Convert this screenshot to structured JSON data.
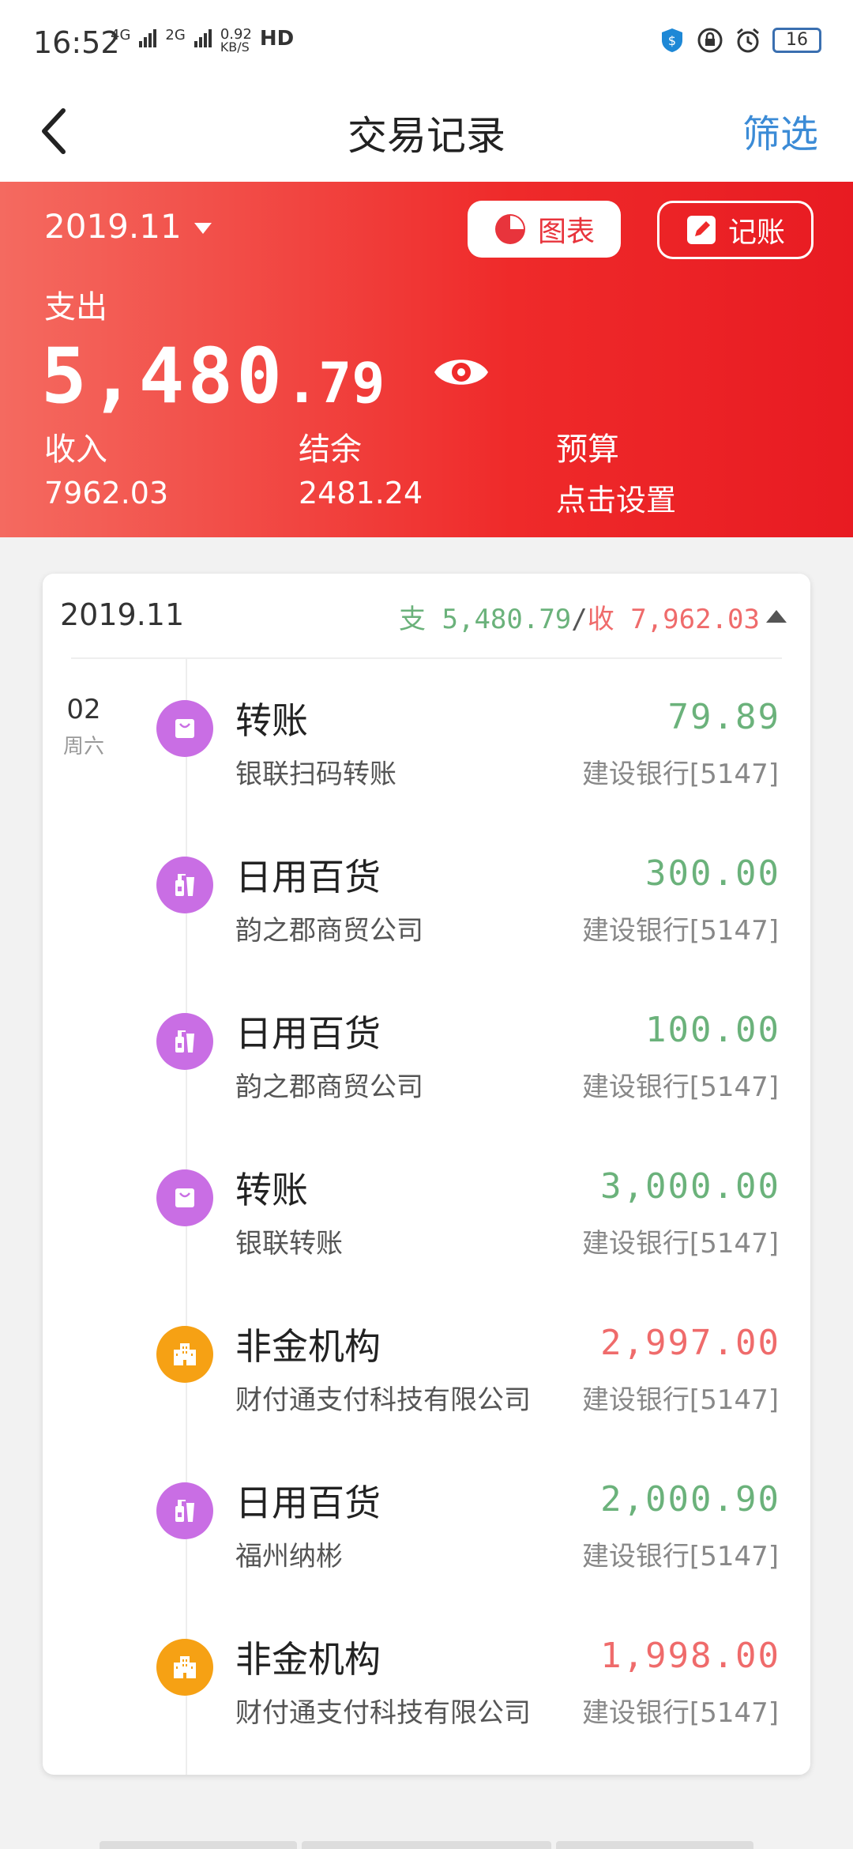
{
  "status": {
    "time": "16:52",
    "net_4g": "4G",
    "net_2g": "2G",
    "speed_value": "0.92",
    "speed_unit": "KB/S",
    "hd": "HD",
    "battery": "16"
  },
  "header": {
    "title": "交易记录",
    "filter_label": "筛选"
  },
  "banner": {
    "month": "2019.11",
    "chart_label": "图表",
    "book_label": "记账",
    "spend_label": "支出",
    "spend_int": "5,480",
    "spend_dec": ".79",
    "income_label": "收入",
    "income_value": "7962.03",
    "balance_label": "结余",
    "balance_value": "2481.24",
    "budget_label": "预算",
    "budget_value": "点击设置"
  },
  "card": {
    "month": "2019.11",
    "out_label": "支",
    "out_total": "5,480.79",
    "separator": "/",
    "in_label": "收",
    "in_total": "7,962.03",
    "date_day": "02",
    "date_week": "周六",
    "transactions": [
      {
        "category": "转账",
        "desc": "银联扫码转账",
        "amount": "79.89",
        "direction": "out",
        "account": "建设银行[5147]",
        "icon": "shopping-bag-icon"
      },
      {
        "category": "日用百货",
        "desc": "韵之郡商贸公司",
        "amount": "300.00",
        "direction": "out",
        "account": "建设银行[5147]",
        "icon": "toiletries-icon"
      },
      {
        "category": "日用百货",
        "desc": "韵之郡商贸公司",
        "amount": "100.00",
        "direction": "out",
        "account": "建设银行[5147]",
        "icon": "toiletries-icon"
      },
      {
        "category": "转账",
        "desc": "银联转账",
        "amount": "3,000.00",
        "direction": "out",
        "account": "建设银行[5147]",
        "icon": "shopping-bag-icon"
      },
      {
        "category": "非金机构",
        "desc": "财付通支付科技有限公司",
        "amount": "2,997.00",
        "direction": "in",
        "account": "建设银行[5147]",
        "icon": "building-icon"
      },
      {
        "category": "日用百货",
        "desc": "福州纳彬",
        "amount": "2,000.90",
        "direction": "out",
        "account": "建设银行[5147]",
        "icon": "toiletries-icon"
      },
      {
        "category": "非金机构",
        "desc": "财付通支付科技有限公司",
        "amount": "1,998.00",
        "direction": "in",
        "account": "建设银行[5147]",
        "icon": "building-icon"
      }
    ]
  },
  "colors": {
    "banner_red": "#ef2a2a",
    "income_red": "#ef6b6b",
    "expense_green": "#6bb27b",
    "link_blue": "#3b8bd6",
    "icon_purple": "#c96ee4",
    "icon_orange": "#f6a114"
  }
}
